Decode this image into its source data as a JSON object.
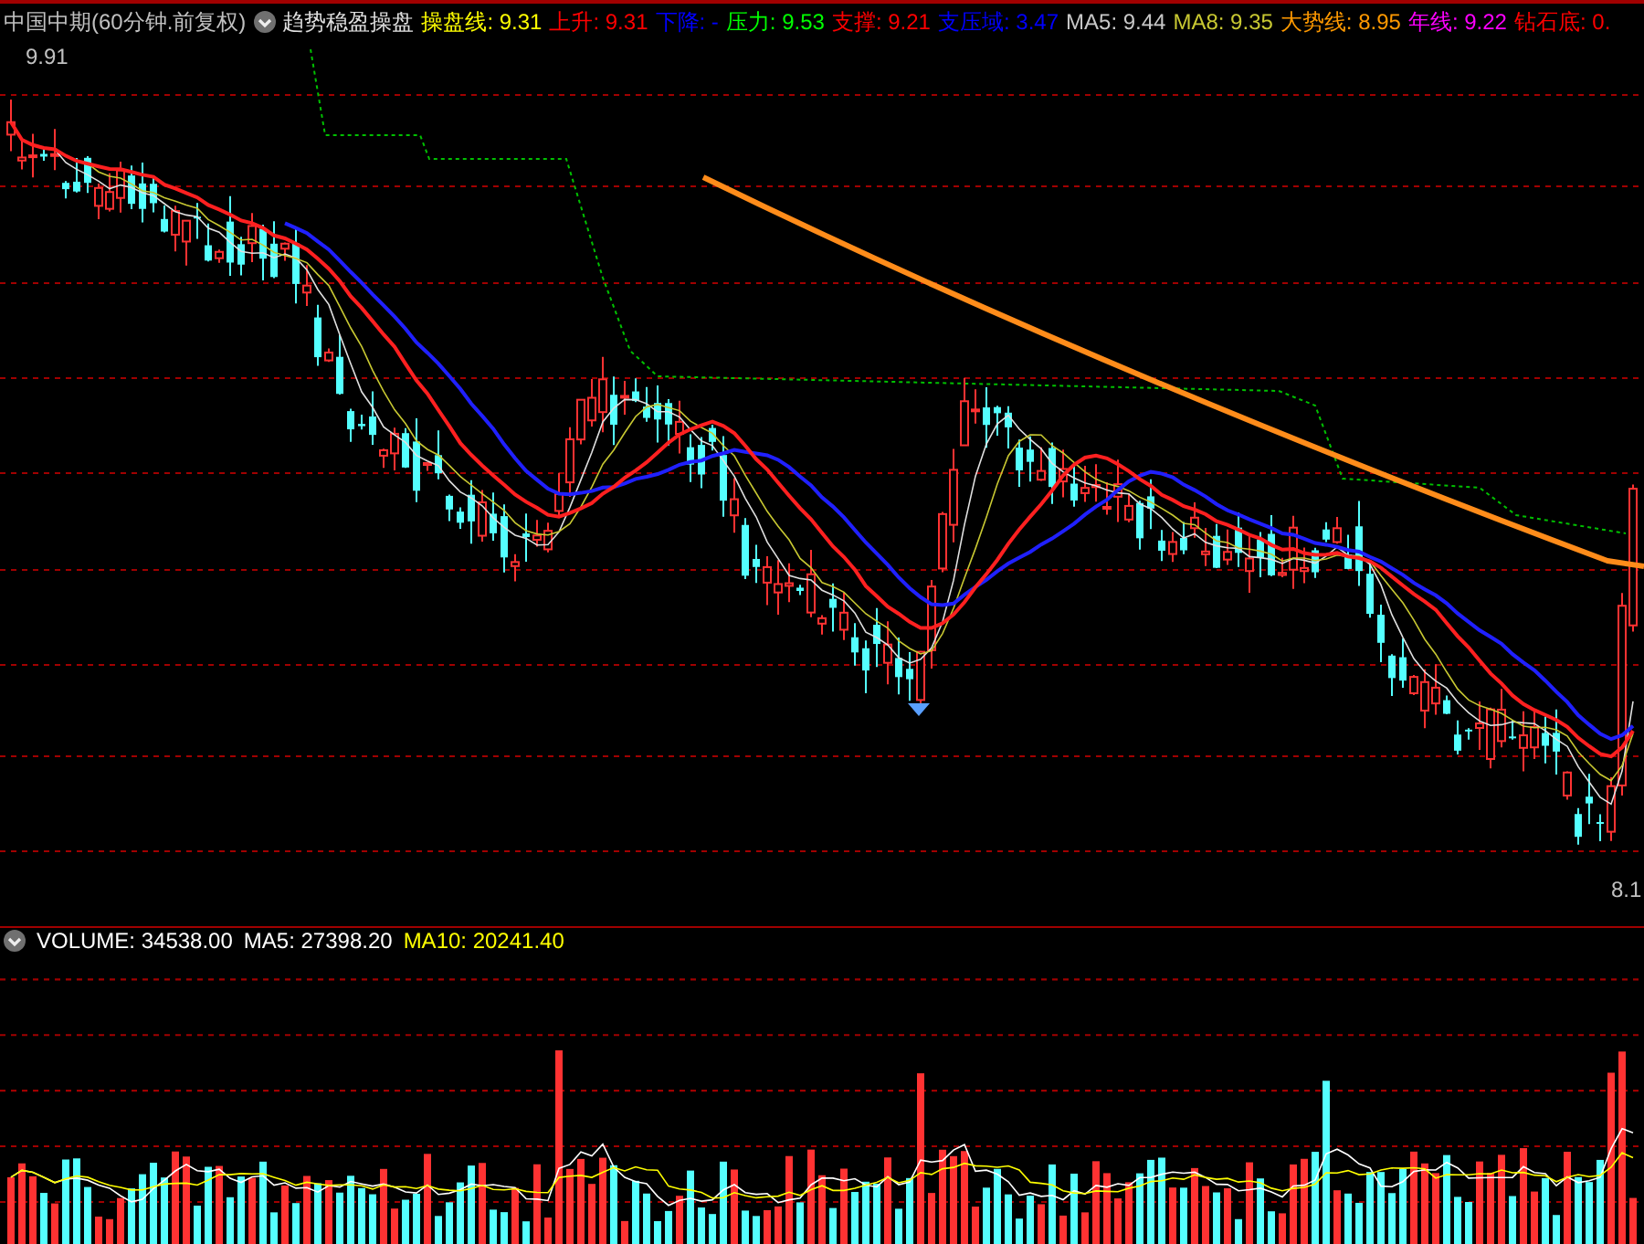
{
  "header": {
    "title": "中国中期(60分钟.前复权)",
    "indicator": "趋势稳盈操盘",
    "legend": [
      {
        "text": "操盘线: 9.31",
        "color": "#ffff00"
      },
      {
        "text": "上升: 9.31",
        "color": "#ff0000"
      },
      {
        "text": "下降: -",
        "color": "#0000ff"
      },
      {
        "text": "压力: 9.53",
        "color": "#00ff00"
      },
      {
        "text": "支撑: 9.21",
        "color": "#ff0000"
      },
      {
        "text": "支压域: 3.47",
        "color": "#0000ff"
      },
      {
        "text": "MA5: 9.44",
        "color": "#c8c8c8"
      },
      {
        "text": "MA8: 9.35",
        "color": "#c8c832"
      },
      {
        "text": "大势线: 8.95",
        "color": "#ff9900"
      },
      {
        "text": "年线: 9.22",
        "color": "#ff00ff"
      },
      {
        "text": "钻石底: 0.",
        "color": "#ff0000"
      }
    ]
  },
  "price_panel": {
    "high_label": "9.91",
    "low_label": "8.1"
  },
  "volume_panel": {
    "legend": [
      {
        "text": "VOLUME: 34538.00",
        "color": "#ffffff"
      },
      {
        "text": "MA5: 27398.20",
        "color": "#ffffff"
      },
      {
        "text": "MA10: 20241.40",
        "color": "#ffff00"
      }
    ]
  }
}
